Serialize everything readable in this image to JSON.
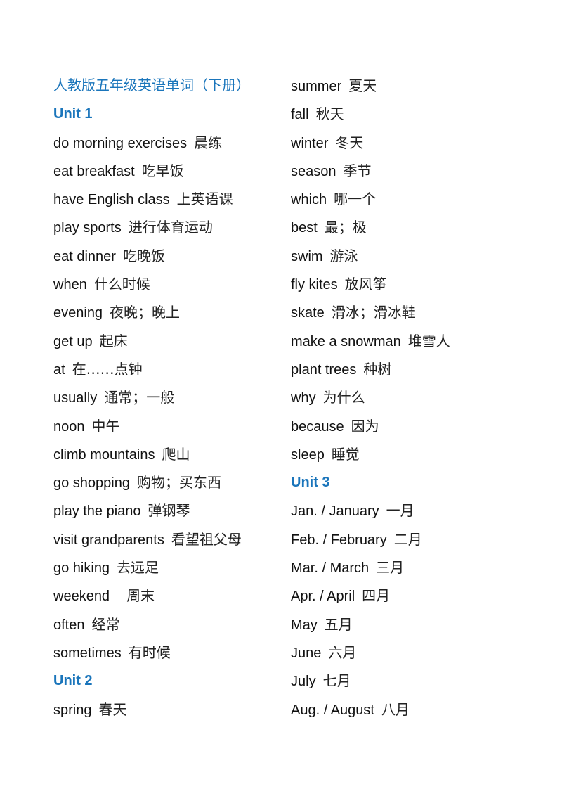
{
  "document": {
    "title": "人教版五年级英语单词（下册）",
    "accent_color": "#1a75bb",
    "left_column": [
      {
        "type": "unit",
        "label": "Unit 1"
      },
      {
        "type": "entry",
        "en": "do morning exercises",
        "zh": "晨练"
      },
      {
        "type": "entry",
        "en": "eat breakfast",
        "zh": "吃早饭"
      },
      {
        "type": "entry",
        "en": "have English class",
        "zh": "上英语课"
      },
      {
        "type": "entry",
        "en": "play sports",
        "zh": "进行体育运动"
      },
      {
        "type": "entry",
        "en": "eat dinner",
        "zh": "吃晚饭"
      },
      {
        "type": "entry",
        "en": "when",
        "zh": "什么时候"
      },
      {
        "type": "entry",
        "en": "evening",
        "zh": "夜晚；晚上"
      },
      {
        "type": "entry",
        "en": "get up",
        "zh": "起床"
      },
      {
        "type": "entry",
        "en": "at",
        "zh": "在……点钟"
      },
      {
        "type": "entry",
        "en": "usually",
        "zh": "通常；一般"
      },
      {
        "type": "entry",
        "en": "noon",
        "zh": "中午"
      },
      {
        "type": "entry",
        "en": "climb mountains",
        "zh": "爬山"
      },
      {
        "type": "entry",
        "en": "go shopping",
        "zh": "购物；买东西"
      },
      {
        "type": "entry",
        "en": "play the piano",
        "zh": "弹钢琴"
      },
      {
        "type": "entry",
        "en": "visit grandparents",
        "zh": "看望祖父母"
      },
      {
        "type": "entry",
        "en": "go hiking",
        "zh": "去远足"
      },
      {
        "type": "entry",
        "en": "weekend",
        "zh": "周末"
      },
      {
        "type": "entry",
        "en": "often",
        "zh": "经常"
      },
      {
        "type": "entry",
        "en": "sometimes",
        "zh": "有时候"
      },
      {
        "type": "unit",
        "label": "Unit 2"
      },
      {
        "type": "entry",
        "en": "spring",
        "zh": "春天"
      }
    ],
    "right_column": [
      {
        "type": "entry",
        "en": "summer",
        "zh": "夏天"
      },
      {
        "type": "entry",
        "en": "fall",
        "zh": "秋天"
      },
      {
        "type": "entry",
        "en": "winter",
        "zh": "冬天"
      },
      {
        "type": "entry",
        "en": "season",
        "zh": "季节"
      },
      {
        "type": "entry",
        "en": "which",
        "zh": "哪一个"
      },
      {
        "type": "entry",
        "en": "best",
        "zh": "最；极"
      },
      {
        "type": "entry",
        "en": "swim",
        "zh": "游泳"
      },
      {
        "type": "entry",
        "en": "fly kites",
        "zh": "放风筝"
      },
      {
        "type": "entry",
        "en": "skate",
        "zh": "滑冰；滑冰鞋"
      },
      {
        "type": "entry",
        "en": "make a snowman",
        "zh": "堆雪人"
      },
      {
        "type": "entry",
        "en": "plant trees",
        "zh": "种树"
      },
      {
        "type": "entry",
        "en": "why",
        "zh": "为什么"
      },
      {
        "type": "entry",
        "en": "because",
        "zh": "因为"
      },
      {
        "type": "entry",
        "en": "sleep",
        "zh": "睡觉"
      },
      {
        "type": "unit",
        "label": "Unit 3"
      },
      {
        "type": "entry",
        "en": "Jan. / January",
        "zh": "一月"
      },
      {
        "type": "entry",
        "en": "Feb. / February",
        "zh": "二月"
      },
      {
        "type": "entry",
        "en": "Mar. / March",
        "zh": "三月"
      },
      {
        "type": "entry",
        "en": "Apr. / April",
        "zh": "四月"
      },
      {
        "type": "entry",
        "en": "May",
        "zh": "五月"
      },
      {
        "type": "entry",
        "en": "June",
        "zh": "六月"
      },
      {
        "type": "entry",
        "en": "July",
        "zh": "七月"
      },
      {
        "type": "entry",
        "en": "Aug. / August",
        "zh": "八月"
      }
    ]
  }
}
